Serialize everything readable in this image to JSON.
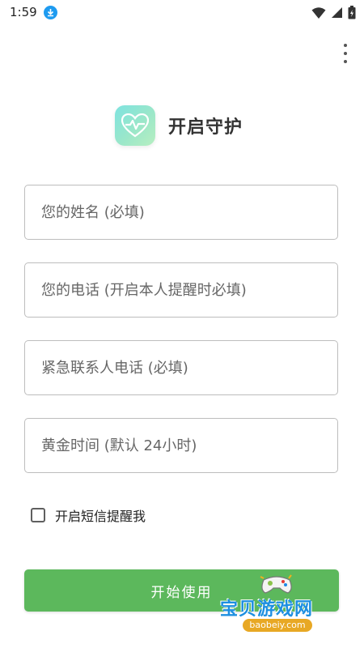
{
  "status_bar": {
    "time": "1:59",
    "icons": [
      "download-icon",
      "wifi-icon",
      "signal-icon",
      "battery-icon"
    ]
  },
  "header": {
    "title": "开启守护",
    "logo_icon": "heart-pulse-icon"
  },
  "form": {
    "name_placeholder": "您的姓名 (必填)",
    "phone_placeholder": "您的电话 (开启本人提醒时必填)",
    "emergency_placeholder": "紧急联系人电话 (必填)",
    "golden_time_placeholder": "黄金时间 (默认 24小时)",
    "sms_checkbox_label": "开启短信提醒我",
    "sms_checked": false
  },
  "start_button_label": "开始使用",
  "watermark": {
    "text": "宝贝游戏网",
    "site": "baobeiy.com"
  },
  "colors": {
    "primary_green": "#5cb85c",
    "logo_gradient_start": "#7ee3e0",
    "logo_gradient_end": "#b7efc1",
    "download_badge": "#1e9bf0"
  }
}
